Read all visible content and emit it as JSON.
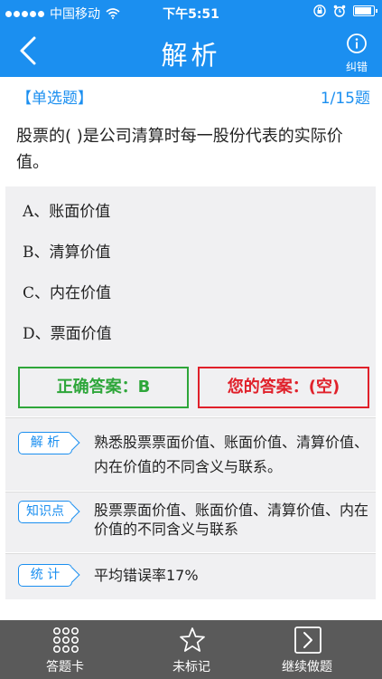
{
  "status_bar": {
    "carrier": "中国移动",
    "time": "下午5:51"
  },
  "nav": {
    "title": "解析",
    "report_label": "纠错"
  },
  "question": {
    "type": "【单选题】",
    "progress": "1/15题",
    "text": "股票的( )是公司清算时每一股份代表的实际价值。",
    "options": [
      {
        "letter": "A",
        "sep": "、",
        "text": "账面价值"
      },
      {
        "letter": "B",
        "sep": "、",
        "text": "清算价值"
      },
      {
        "letter": "C",
        "sep": "、",
        "text": "内在价值"
      },
      {
        "letter": "D",
        "sep": "、",
        "text": "票面价值"
      }
    ]
  },
  "answers": {
    "correct": "正确答案：B",
    "yours": "您的答案：(空)"
  },
  "sections": {
    "analysis": {
      "tag": "解 析",
      "text": "熟悉股票票面价值、账面价值、清算价值、内在价值的不同含义与联系。"
    },
    "knowledge": {
      "tag": "知识点",
      "text": "股票票面价值、账面价值、清算价值、内在价值的不同含义与联系"
    },
    "stats": {
      "tag": "统 计",
      "text": "平均错误率17%"
    }
  },
  "tabbar": {
    "card_label": "答题卡",
    "mark_label": "未标记",
    "continue_label": "继续做题"
  },
  "colors": {
    "brand": "#1b8ff0",
    "correct": "#2ea63a",
    "wrong": "#e0202a",
    "tabbar": "#5a5a5a"
  }
}
